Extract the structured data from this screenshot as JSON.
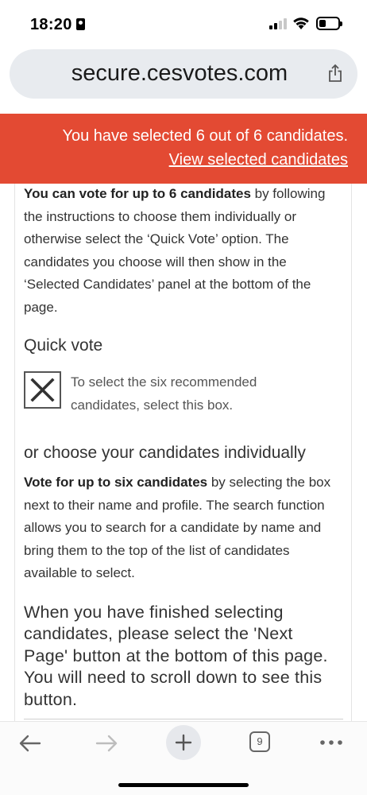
{
  "status_bar": {
    "time": "18:20"
  },
  "browser": {
    "url": "secure.cesvotes.com",
    "tab_count": "9"
  },
  "banner": {
    "message": "You have selected 6 out of 6 candidates.",
    "link": "View selected candidates",
    "color": "#e34a33"
  },
  "content": {
    "intro_bold": "You can vote for up to 6 candidates",
    "intro_rest": " by following the instructions to choose them individually or otherwise select the ‘Quick Vote’ option. The candidates you choose will then show in the ‘Selected Candidates’ panel at the bottom of the page.",
    "quick_vote_heading": "Quick vote",
    "quick_vote_checked": true,
    "quick_vote_text": "To select the six recommended candidates, select this box.",
    "individual_heading": "or choose your candidates individually",
    "vote_bold": "Vote for up to six candidates",
    "vote_rest": " by selecting the box next to their name and profile. The search function allows you to search for a candidate by name and bring them to the top of the list of candidates available to select.",
    "finish_text": "When you have finished selecting candidates, please select the 'Next Page' button at the bottom of this page. You will need to scroll down to see this button."
  }
}
